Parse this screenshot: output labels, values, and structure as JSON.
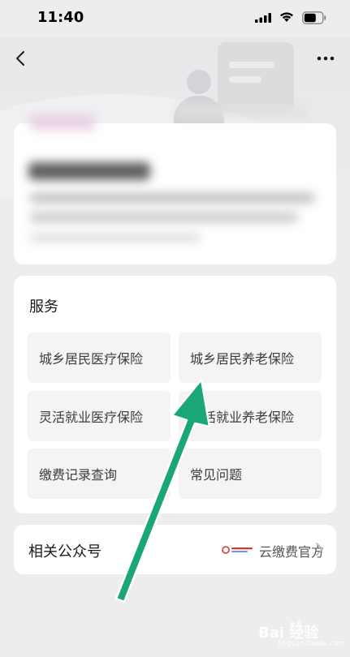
{
  "status_bar": {
    "time": "11:40"
  },
  "header": {
    "back_icon": "chevron-left-icon",
    "more_icon": "more-dots-icon"
  },
  "services": {
    "title": "服务",
    "items": [
      {
        "label": "城乡居民医疗保险"
      },
      {
        "label": "城乡居民养老保险"
      },
      {
        "label": "灵活就业医疗保险"
      },
      {
        "label": "灵活就业养老保险"
      },
      {
        "label": "缴费记录查询"
      },
      {
        "label": "常见问题"
      }
    ]
  },
  "related": {
    "title": "相关公众号",
    "account_name": "云缴费官方",
    "chevron_icon": "chevron-right-icon"
  },
  "annotation": {
    "arrow_color": "#1aa676"
  },
  "watermark": {
    "text": "Bai 经验",
    "sub": "jingyan.baidu.com"
  }
}
